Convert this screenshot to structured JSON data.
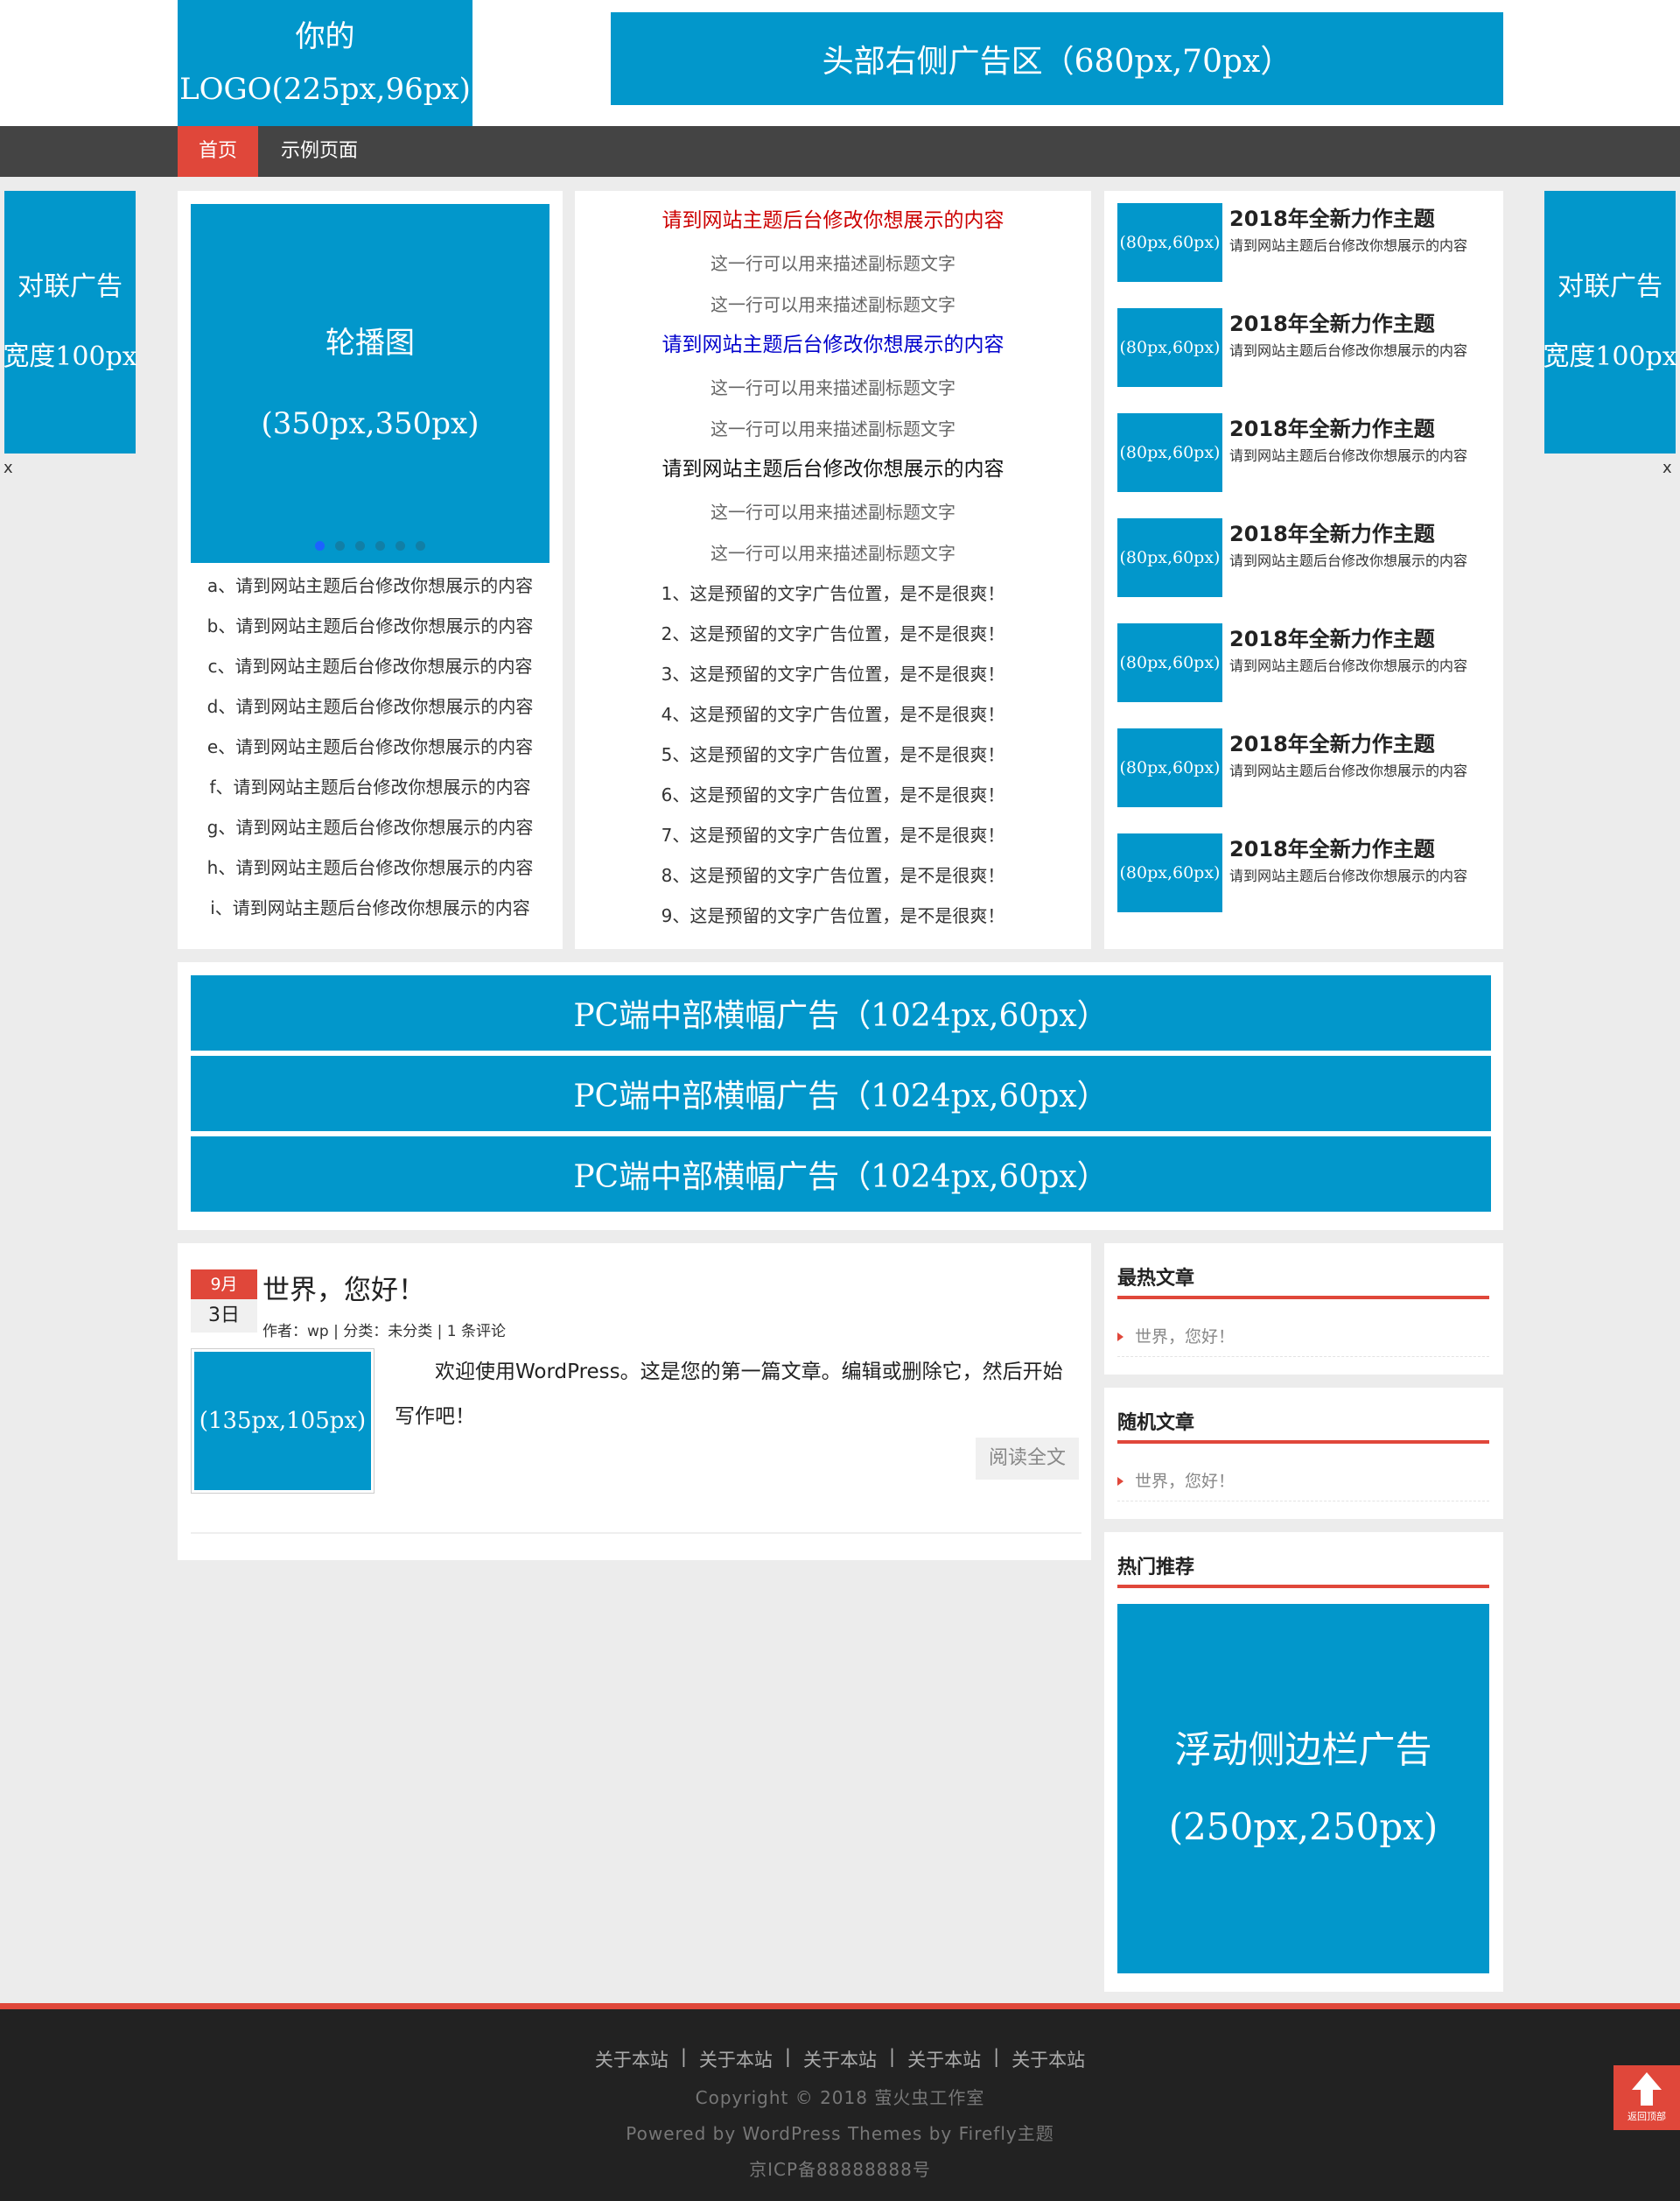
{
  "header": {
    "logo_line1": "你的",
    "logo_line2": "LOGO(225px,96px)",
    "ad_text": "头部右侧广告区（680px,70px）"
  },
  "nav": {
    "items": [
      {
        "label": "首页",
        "active": true
      },
      {
        "label": "示例页面",
        "active": false
      }
    ]
  },
  "couplet": {
    "left_line1": "对联广告",
    "left_line2": "宽度100px",
    "right_line1": "对联广告",
    "right_line2": "宽度100px",
    "close": "x"
  },
  "slider": {
    "line1": "轮播图",
    "line2": "(350px,350px)",
    "dot_count": 6,
    "active_dot": 0
  },
  "left_list": [
    "a、请到网站主题后台修改你想展示的内容",
    "b、请到网站主题后台修改你想展示的内容",
    "c、请到网站主题后台修改你想展示的内容",
    "d、请到网站主题后台修改你想展示的内容",
    "e、请到网站主题后台修改你想展示的内容",
    "f、请到网站主题后台修改你想展示的内容",
    "g、请到网站主题后台修改你想展示的内容",
    "h、请到网站主题后台修改你想展示的内容",
    "i、请到网站主题后台修改你想展示的内容"
  ],
  "mid": {
    "blocks": [
      {
        "title": "请到网站主题后台修改你想展示的内容",
        "color": "#cc0000",
        "subs": [
          "这一行可以用来描述副标题文字",
          "这一行可以用来描述副标题文字"
        ]
      },
      {
        "title": "请到网站主题后台修改你想展示的内容",
        "color": "#0000cc",
        "subs": [
          "这一行可以用来描述副标题文字",
          "这一行可以用来描述副标题文字"
        ]
      },
      {
        "title": "请到网站主题后台修改你想展示的内容",
        "color": "#111111",
        "subs": [
          "这一行可以用来描述副标题文字",
          "这一行可以用来描述副标题文字"
        ]
      }
    ],
    "ads": [
      "1、这是预留的文字广告位置，是不是很爽！",
      "2、这是预留的文字广告位置，是不是很爽！",
      "3、这是预留的文字广告位置，是不是很爽！",
      "4、这是预留的文字广告位置，是不是很爽！",
      "5、这是预留的文字广告位置，是不是很爽！",
      "6、这是预留的文字广告位置，是不是很爽！",
      "7、这是预留的文字广告位置，是不是很爽！",
      "8、这是预留的文字广告位置，是不是很爽！",
      "9、这是预留的文字广告位置，是不是很爽！"
    ]
  },
  "right_list": [
    {
      "thumb": "(80px,60px)",
      "title": "2018年全新力作主题",
      "desc": "请到网站主题后台修改你想展示的内容"
    },
    {
      "thumb": "(80px,60px)",
      "title": "2018年全新力作主题",
      "desc": "请到网站主题后台修改你想展示的内容"
    },
    {
      "thumb": "(80px,60px)",
      "title": "2018年全新力作主题",
      "desc": "请到网站主题后台修改你想展示的内容"
    },
    {
      "thumb": "(80px,60px)",
      "title": "2018年全新力作主题",
      "desc": "请到网站主题后台修改你想展示的内容"
    },
    {
      "thumb": "(80px,60px)",
      "title": "2018年全新力作主题",
      "desc": "请到网站主题后台修改你想展示的内容"
    },
    {
      "thumb": "(80px,60px)",
      "title": "2018年全新力作主题",
      "desc": "请到网站主题后台修改你想展示的内容"
    },
    {
      "thumb": "(80px,60px)",
      "title": "2018年全新力作主题",
      "desc": "请到网站主题后台修改你想展示的内容"
    }
  ],
  "banners": [
    "PC端中部横幅广告（1024px,60px）",
    "PC端中部横幅广告（1024px,60px）",
    "PC端中部横幅广告（1024px,60px）"
  ],
  "post": {
    "month": "9月",
    "day": "3日",
    "title": "世界，您好！",
    "meta": "作者：wp | 分类：未分类 | 1 条评论",
    "thumb": "(135px,105px)",
    "excerpt": "欢迎使用WordPress。这是您的第一篇文章。编辑或删除它，然后开始写作吧！",
    "read_more": "阅读全文"
  },
  "widgets": {
    "hot_title": "最热文章",
    "hot_item": "世界，您好！",
    "random_title": "随机文章",
    "random_item": "世界，您好！",
    "recommend_title": "热门推荐",
    "float_ad_line1": "浮动侧边栏广告",
    "float_ad_line2": "(250px,250px)"
  },
  "footer": {
    "links": [
      "关于本站",
      "关于本站",
      "关于本站",
      "关于本站",
      "关于本站"
    ],
    "separator": "|",
    "copyright": "Copyright © 2018 萤火虫工作室",
    "powered": "Powered by WordPress Themes by Firefly主题",
    "icp": "京ICP备88888888号",
    "back_top": "返回顶部"
  },
  "colors": {
    "accent": "#e0473a",
    "ad_blue": "#0297cb",
    "nav_bg": "#444444",
    "footer_bg": "#222222"
  },
  "icons": [
    "close-icon",
    "arrow-right-icon",
    "arrow-up-icon"
  ]
}
